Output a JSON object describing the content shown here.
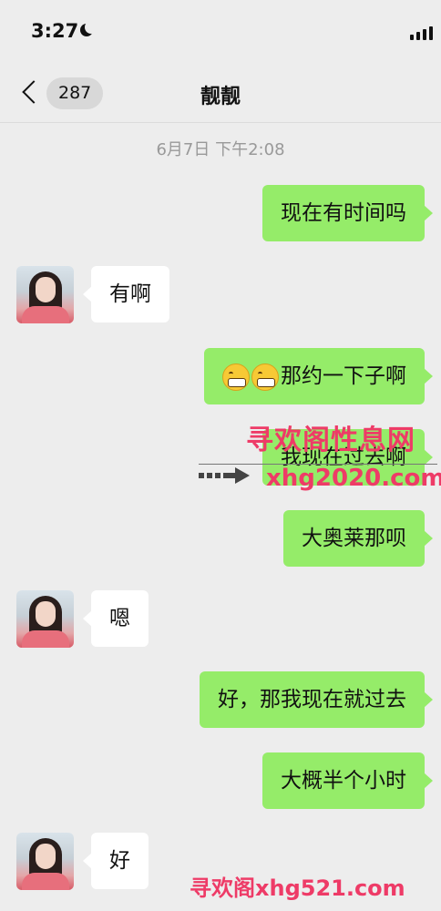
{
  "status_bar": {
    "time": "3:27"
  },
  "nav": {
    "unread_count": "287",
    "title": "靓靓"
  },
  "chat": {
    "timestamp": "6月7日 下午2:08",
    "messages": [
      {
        "side": "out",
        "text": "现在有时间吗"
      },
      {
        "side": "in",
        "text": "有啊"
      },
      {
        "side": "out",
        "text": "那约一下子啊",
        "emoji": "grimacing-face-icon"
      },
      {
        "side": "out",
        "text": "我现在过去啊"
      },
      {
        "side": "out",
        "text": "大奥莱那呗"
      },
      {
        "side": "in",
        "text": "嗯"
      },
      {
        "side": "out",
        "text": "好，那我现在就过去"
      },
      {
        "side": "out",
        "text": "大概半个小时"
      },
      {
        "side": "in",
        "text": "好"
      }
    ]
  },
  "watermarks": {
    "line1": "寻欢阁性息网",
    "line2": "xhg2020.com",
    "bottom": "寻欢阁xhg521.com"
  },
  "colors": {
    "outgoing_bubble": "#95ec69",
    "incoming_bubble": "#ffffff",
    "background": "#ededed",
    "watermark": "#ee3b67"
  }
}
